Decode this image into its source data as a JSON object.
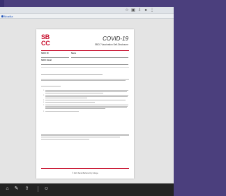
{
  "colors": {
    "brand_red": "#c8102e",
    "background": "#4b3f7d",
    "viewer": "#e4e4e4"
  },
  "browser": {
    "tab_label": "Mozilla",
    "toolbar_icons": [
      "star-icon",
      "extensions-icon",
      "download-icon",
      "menu-icon"
    ]
  },
  "document": {
    "logo_lines": [
      "SB",
      "CC"
    ],
    "title": "COVID-19",
    "subtitle": "SBCC Vaccination Self-Disclosure",
    "fields": {
      "student_id_label": "SBCC ID",
      "name_label": "Name",
      "email_label": "SBCC Email"
    },
    "footer": "© 2021 Santa Barbara City College"
  },
  "taskbar": {
    "icons": [
      "folder-icon",
      "pen-icon",
      "upload-icon",
      "person-icon"
    ]
  }
}
